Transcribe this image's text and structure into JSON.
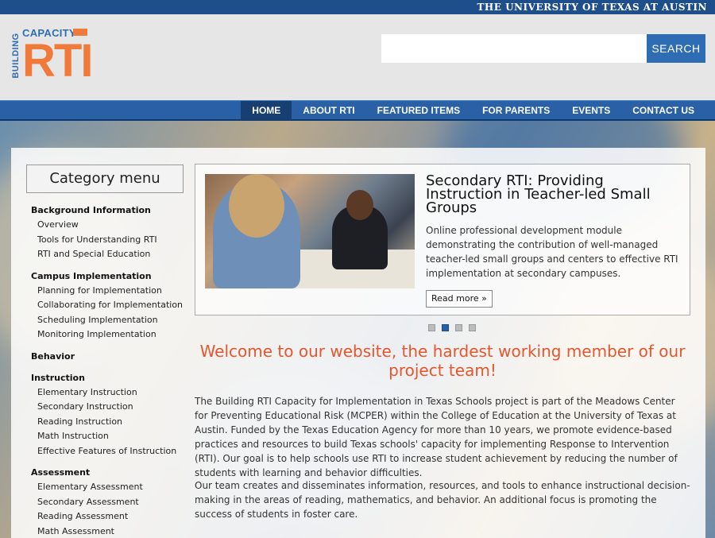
{
  "top_bar": {
    "university": "THE UNIVERSITY OF TEXAS AT AUSTIN"
  },
  "logo": {
    "building": "BUILDING",
    "capacity": "CAPACITY",
    "rti": "RTI"
  },
  "search": {
    "placeholder": "",
    "button": "SEARCH"
  },
  "nav": {
    "items": [
      {
        "label": "HOME",
        "active": true
      },
      {
        "label": "ABOUT RTI",
        "active": false
      },
      {
        "label": "FEATURED ITEMS",
        "active": false
      },
      {
        "label": "FOR PARENTS",
        "active": false
      },
      {
        "label": "EVENTS",
        "active": false
      },
      {
        "label": "CONTACT US",
        "active": false
      }
    ]
  },
  "sidebar": {
    "title": "Category menu",
    "groups": [
      {
        "heading": "Background Information",
        "items": [
          "Overview",
          "Tools for Understanding RTI",
          "RTI and Special Education"
        ]
      },
      {
        "heading": "Campus Implementation",
        "items": [
          "Planning for Implementation",
          "Collaborating for Implementation",
          "Scheduling Implementation",
          "Monitoring Implementation"
        ]
      },
      {
        "heading": "Behavior",
        "items": []
      },
      {
        "heading": "Instruction",
        "items": [
          "Elementary Instruction",
          "Secondary Instruction",
          "Reading Instruction",
          "Math Instruction",
          "Effective Features of Instruction"
        ]
      },
      {
        "heading": "Assessment",
        "items": [
          "Elementary Assessment",
          "Secondary Assessment",
          "Reading Assessment",
          "Math Assessment"
        ]
      }
    ]
  },
  "slider": {
    "title": "Secondary RTI: Providing Instruction in Teacher-led Small Groups",
    "description": "Online professional development module demonstrating the contribution of well-managed teacher-led small groups and centers to effective RTI implementation at secondary campuses.",
    "read_more": "Read more »",
    "dots": 4,
    "active_dot": 2
  },
  "main": {
    "welcome": "Welcome to our website, the hardest working member of our project team!",
    "paragraph1": "The Building RTI Capacity for Implementation in Texas Schools project is part of the Meadows Center for Preventing Educational Risk (MCPER) within the College of Education at the University of Texas at Austin. Funded by the Texas Education Agency for more than 10 years, we promote evidence-based practices and resources to build Texas schools' capacity for implementing Response to Intervention (RTI). Our goal is to help schools use RTI to increase student achievement by reducing the number of students with learning and behavior difficulties.",
    "paragraph2": "Our team creates and disseminates information, resources, and tools to enhance instructional decision-making in the areas of reading, mathematics, and behavior. An additional focus is promoting the success of students in foster care."
  },
  "colors": {
    "brand_blue": "#2a60a5",
    "brand_orange": "#f07a3a",
    "welcome_orange": "#e4572e",
    "ut_blue": "#1f4f8a"
  }
}
